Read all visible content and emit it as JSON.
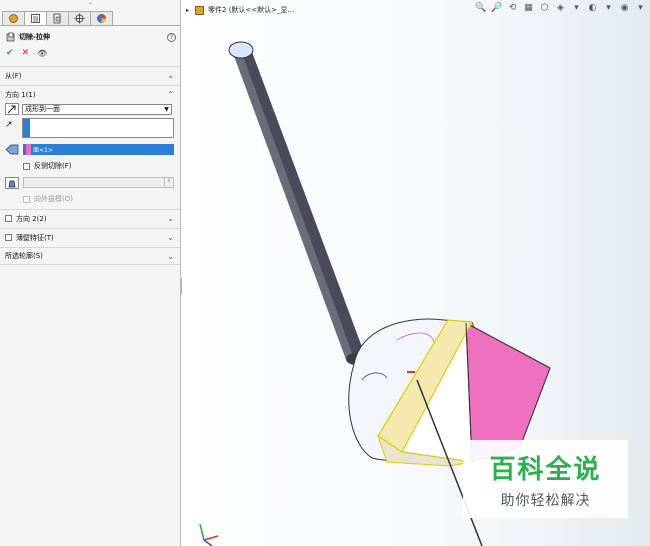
{
  "panel": {
    "grip": "⌃",
    "tabs": [
      {
        "icon": "feature-manager-icon"
      },
      {
        "icon": "property-manager-icon"
      },
      {
        "icon": "configuration-manager-icon"
      },
      {
        "icon": "dimxpert-icon"
      },
      {
        "icon": "display-manager-icon"
      }
    ],
    "feature_title": "切除-拉伸",
    "help": "?",
    "ok": "✔",
    "cancel": "✕",
    "preview": "👁",
    "sections": {
      "from": "从(F)",
      "direction1": "方向 1(1)",
      "direction2": "方向 2(2)",
      "thin_feature": "薄壁特征(T)",
      "selected_contours": "所选轮廓(S)"
    },
    "end_condition": "成形到一面",
    "face_selection": "面<1>",
    "flip_side": "反侧切除(F)",
    "draft_outward": "向外拔模(O)",
    "spin_up_down": "⇕"
  },
  "viewport": {
    "breadcrumb": "零件2  (默认<<默认>_显...",
    "tools": [
      "🔍",
      "🔎",
      "⟲",
      "▦",
      "⬡",
      "◈",
      "▾",
      "◐",
      "▾",
      "◉",
      "▾"
    ]
  },
  "watermark": {
    "main": "百科全说",
    "sub": "助你轻松解决"
  },
  "colors": {
    "selection": "#2b7fd6",
    "face_pink": "#f070c0",
    "handle": "#4a4a5a",
    "wm_green": "#2fae4e"
  }
}
